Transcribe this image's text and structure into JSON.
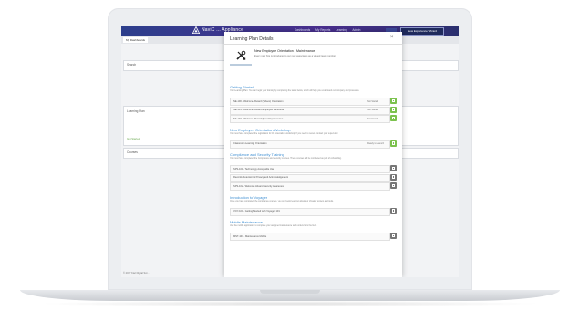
{
  "app": {
    "brand": "NaviC ... Appliance",
    "nav": [
      "Dashboards",
      "My Reports",
      "Learning",
      "Admin"
    ],
    "top_button": "New Experience Wizard",
    "subtab": "My Dashboards",
    "footer": "© 2017 Kiwi Digital Sol..."
  },
  "background": {
    "search_label": "Search",
    "learning_label": "Learning Plan",
    "courses_label": "Courses",
    "green_link": "Get Started"
  },
  "modal": {
    "title": "Learning Plan Details",
    "close": "×",
    "hero_title": "New Employee Orientation - Maintenance",
    "hero_desc": "Every new hire is introduced to our new associates as a valued team member.",
    "sections": [
      {
        "title": "Getting Started",
        "desc": "Your Learning Plan: You can begin your training by completing the tasks below, which will help you understand our company and processes.",
        "rows": [
          {
            "label": "NE-100 - Welcome Aboard (Videos) Orientation",
            "status": "Not Started",
            "action": "start"
          },
          {
            "label": "NE-101 - Welcome Aboard Employee Handbook",
            "status": "Not Started",
            "action": "start"
          },
          {
            "label": "NE-102 - Welcome Aboard (Benefits) Overview",
            "status": "Not Started",
            "action": "start"
          }
        ]
      },
      {
        "title": "New Employee Orientation Workshop",
        "desc": "You must have completed the registration for the orientation workshop. If you need to review, contact your supervisor.",
        "rows": [
          {
            "label": "Classroom Learning Orientation",
            "status": "Ready to Launch",
            "action": "start"
          }
        ]
      },
      {
        "title": "Compliance and Security Training",
        "desc": "You must have completed the Compliance and Security courses. These courses will be completed as part of onboarding.",
        "rows": [
          {
            "label": "SPS-101 - Technology Acceptable Use",
            "status": "",
            "action": "locked"
          },
          {
            "label": "Records Retention & Privacy and Acknowledgement",
            "status": "",
            "action": "locked"
          },
          {
            "label": "SPS-102 - Welcome Aboard Security Awareness",
            "status": "",
            "action": "locked"
          }
        ]
      },
      {
        "title": "Introduction to Voyager",
        "desc": "Once you have completed the compliance courses, you can begin learning about our Voyager system and tools.",
        "rows": [
          {
            "label": "VOY-100 - Getting Started with Voyager 101",
            "status": "",
            "action": "locked"
          }
        ]
      },
      {
        "title": "Mobile Maintenance",
        "desc": "Use the mobile application to complete your assigned maintenance work orders from the field.",
        "rows": [
          {
            "label": "MNT-101 - Maintenance Mobile",
            "status": "",
            "action": "locked"
          }
        ]
      }
    ]
  }
}
